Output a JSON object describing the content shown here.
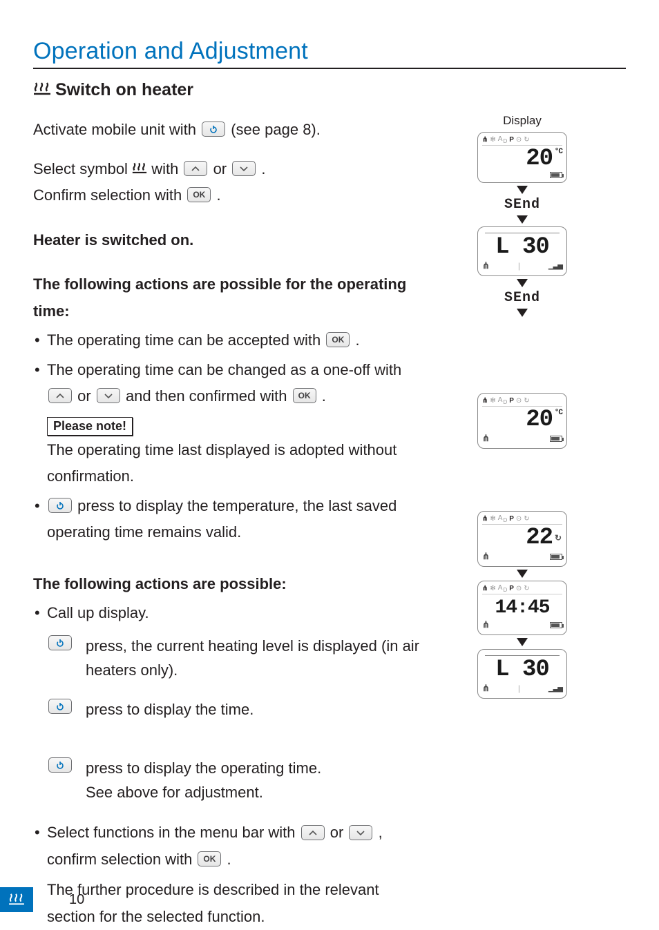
{
  "heading": "Operation and Adjustment",
  "section": {
    "title": "Switch on heater"
  },
  "para1_a": "Activate mobile unit with ",
  "para1_b": " (see page 8).",
  "para2_a": "Select symbol ",
  "para2_b": " with ",
  "para2_c": " or ",
  "para2_d": ".",
  "para3_a": "Confirm selection with ",
  "para3_b": ".",
  "heater_on": "Heater is switched on.",
  "actions_time_head": "The following actions are possible for the operating time:",
  "bullet_time_1a": "The operating time can be accepted with ",
  "bullet_time_1b": ".",
  "bullet_time_2a": "The operating time can be changed as a one-off with ",
  "bullet_time_2b": " or ",
  "bullet_time_2c": " and then confirmed with ",
  "bullet_time_2d": ".",
  "please_note": "Please note!",
  "note_text": "The operating time last displayed is adopted without confirmation.",
  "bullet_power_a": " press to display the temperature, the last saved operating time remains valid.",
  "actions_head2": "The following actions are possible:",
  "bullet_call": "Call up display.",
  "press1": "press, the current heating level is displayed (in air heaters only).",
  "press2": "press to display the time.",
  "press3a": "press to display the operating time.",
  "press3b": "See above for adjustment.",
  "bullet_select_a": "Select functions in the menu bar with ",
  "bullet_select_b": " or ",
  "bullet_select_c": ", confirm selection with ",
  "bullet_select_d": ".",
  "bullet_select_tail": "The further procedure is described in the relevant section for the selected function.",
  "buttons": {
    "ok": "OK",
    "back": "◂",
    "fwd": "▸"
  },
  "display_label": "Display",
  "lcds": {
    "top_sym": "A P",
    "sub_d": "D",
    "temp20": "20",
    "degc": "°C",
    "send": "SEnd",
    "l30": "L 30",
    "temp22": "22",
    "time": "14:45"
  },
  "page_number": "10"
}
